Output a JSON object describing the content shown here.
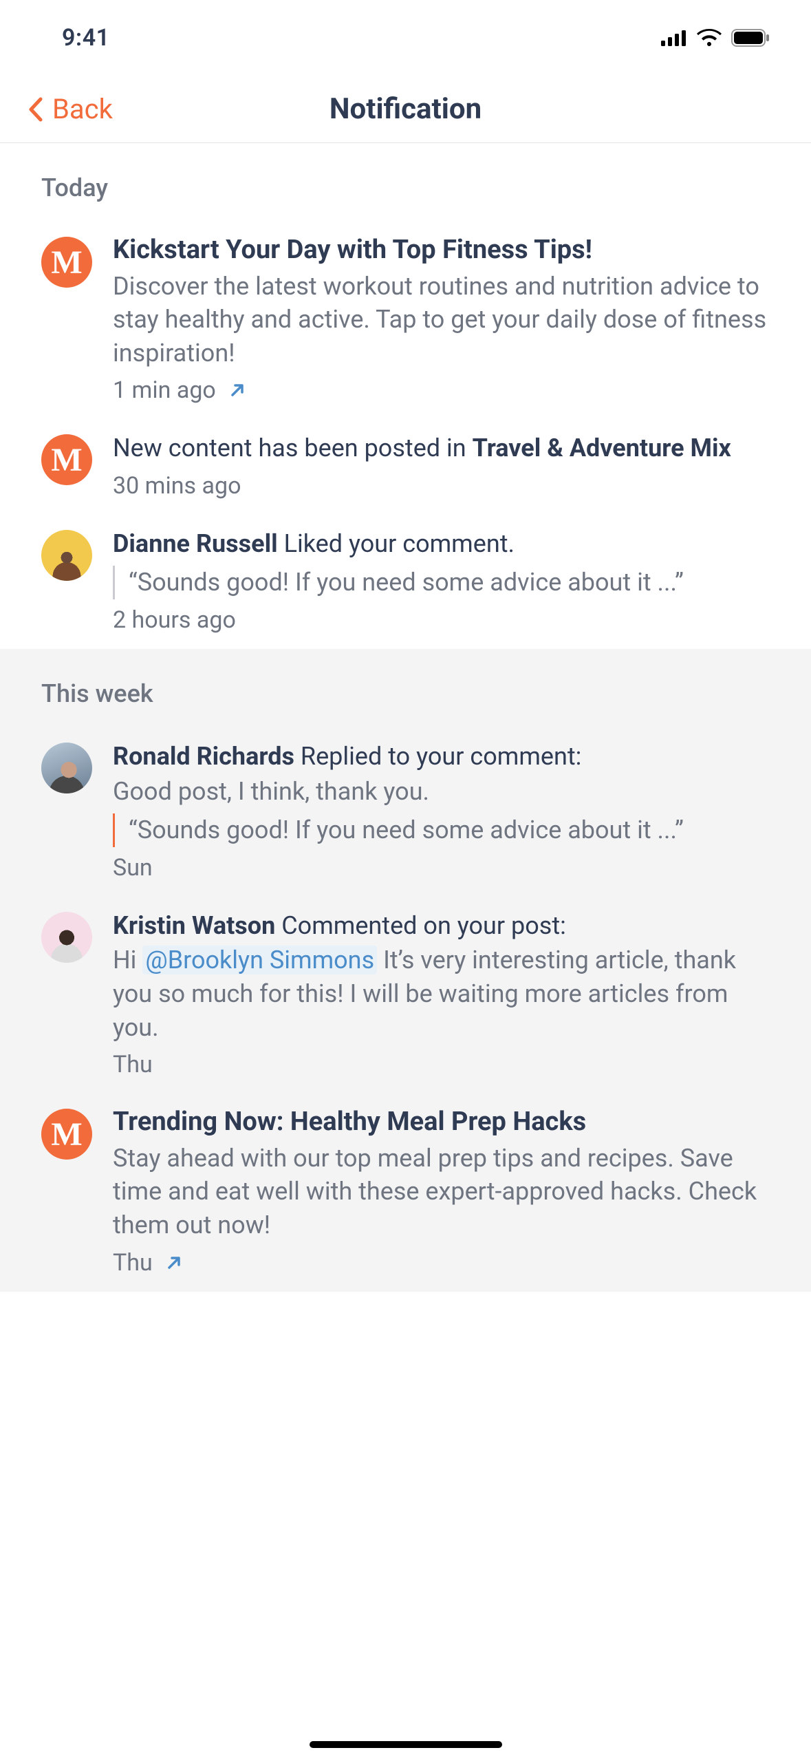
{
  "status": {
    "time": "9:41"
  },
  "header": {
    "back_label": "Back",
    "title": "Notification"
  },
  "colors": {
    "accent": "#F26B3A",
    "link": "#4A8CC9"
  },
  "sections": {
    "today": {
      "heading": "Today",
      "items": [
        {
          "avatar": "M",
          "title": "Kickstart Your Day with Top Fitness Tips!",
          "body": "Discover the latest workout routines and nutrition advice to stay healthy and active. Tap to get your daily dose of fitness inspiration!",
          "time": "1 min ago",
          "external": true
        },
        {
          "avatar": "M",
          "title_pre": "New content has been posted in ",
          "title_bold": "Travel & Adventure Mix",
          "time": "30 mins ago"
        },
        {
          "actor": "Dianne Russell",
          "action": "Liked your comment.",
          "quote": "“Sounds good! If you need some advice about it ...”",
          "time": "2 hours ago"
        }
      ]
    },
    "week": {
      "heading": "This week",
      "items": [
        {
          "actor": "Ronald Richards",
          "action": "Replied to your comment:",
          "reply_body": "Good post, I think, thank you.",
          "quote": "“Sounds good! If you need some advice about it ...”",
          "time": "Sun"
        },
        {
          "actor": "Kristin Watson",
          "action": "Commented on your post:",
          "reply_pre": "Hi ",
          "mention": "@Brooklyn Simmons",
          "reply_post": " It’s very interesting article, thank you so much for this! I will be waiting more articles from you.",
          "time": "Thu"
        },
        {
          "avatar": "M",
          "title": "Trending Now: Healthy Meal Prep Hacks",
          "body": "Stay ahead with our top meal prep tips and recipes. Save time and eat well with these expert-approved hacks. Check them out now!",
          "time": "Thu",
          "external": true
        }
      ]
    }
  }
}
